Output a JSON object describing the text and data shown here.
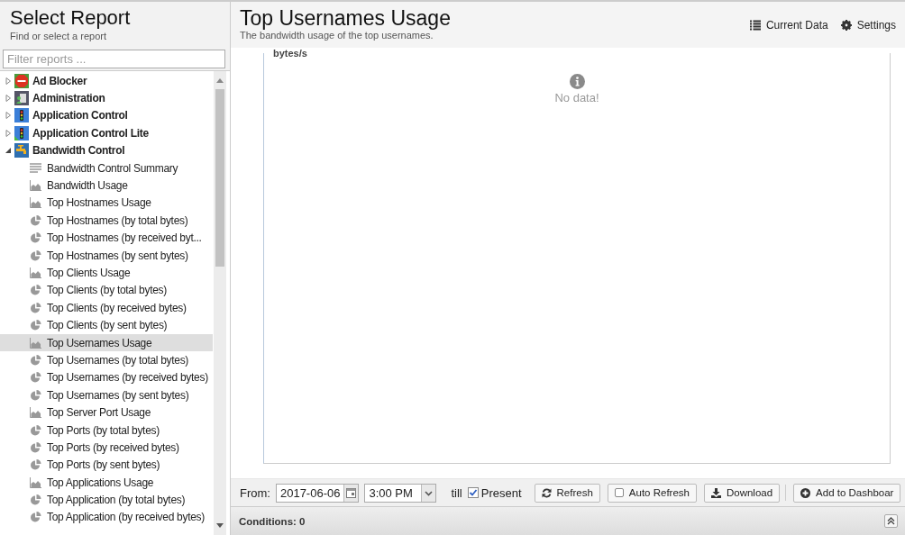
{
  "sidebar": {
    "title": "Select Report",
    "subtitle": "Find or select a report",
    "filter": {
      "placeholder": "Filter reports ..."
    },
    "tree": [
      {
        "label": "Ad Blocker",
        "kind": "ads",
        "expanded": false
      },
      {
        "label": "Administration",
        "kind": "admin",
        "expanded": false
      },
      {
        "label": "Application Control",
        "kind": "signal",
        "expanded": false
      },
      {
        "label": "Application Control Lite",
        "kind": "signal-lite",
        "expanded": false
      },
      {
        "label": "Bandwidth Control",
        "kind": "tap",
        "expanded": true,
        "children": [
          {
            "label": "Bandwidth Control Summary",
            "kind": "text",
            "selected": false
          },
          {
            "label": "Bandwidth Usage",
            "kind": "area",
            "selected": false
          },
          {
            "label": "Top Hostnames Usage",
            "kind": "area",
            "selected": false
          },
          {
            "label": "Top Hostnames (by total bytes)",
            "kind": "pie",
            "selected": false
          },
          {
            "label": "Top Hostnames (by received byt...",
            "kind": "pie",
            "selected": false
          },
          {
            "label": "Top Hostnames (by sent bytes)",
            "kind": "pie",
            "selected": false
          },
          {
            "label": "Top Clients Usage",
            "kind": "area",
            "selected": false
          },
          {
            "label": "Top Clients (by total bytes)",
            "kind": "pie",
            "selected": false
          },
          {
            "label": "Top Clients (by received bytes)",
            "kind": "pie",
            "selected": false
          },
          {
            "label": "Top Clients (by sent bytes)",
            "kind": "pie",
            "selected": false
          },
          {
            "label": "Top Usernames Usage",
            "kind": "area",
            "selected": true
          },
          {
            "label": "Top Usernames (by total bytes)",
            "kind": "pie",
            "selected": false
          },
          {
            "label": "Top Usernames (by received bytes)",
            "kind": "pie",
            "selected": false
          },
          {
            "label": "Top Usernames (by sent bytes)",
            "kind": "pie",
            "selected": false
          },
          {
            "label": "Top Server Port Usage",
            "kind": "area",
            "selected": false
          },
          {
            "label": "Top Ports (by total bytes)",
            "kind": "pie",
            "selected": false
          },
          {
            "label": "Top Ports (by received bytes)",
            "kind": "pie",
            "selected": false
          },
          {
            "label": "Top Ports (by sent bytes)",
            "kind": "pie",
            "selected": false
          },
          {
            "label": "Top Applications Usage",
            "kind": "area",
            "selected": false
          },
          {
            "label": "Top Application (by total bytes)",
            "kind": "pie",
            "selected": false
          },
          {
            "label": "Top Application (by received bytes)",
            "kind": "pie",
            "selected": false
          }
        ]
      }
    ]
  },
  "report": {
    "title": "Top Usernames Usage",
    "description": "The bandwidth usage of the top usernames.",
    "actions": [
      {
        "label": "Current Data",
        "kind": "list"
      },
      {
        "label": "Settings",
        "kind": "gear"
      }
    ],
    "chart": {
      "ylabel": "bytes/s",
      "message": "No data!"
    },
    "toolbar": {
      "from_label": "From:",
      "date": "2017-06-06",
      "time": "3:00 PM",
      "till_label": "till",
      "present": {
        "label": "Present",
        "checked": true
      },
      "buttons": [
        {
          "label": "Refresh",
          "kind": "refresh"
        },
        {
          "label": "Auto Refresh",
          "kind": "toggle",
          "checked": false
        },
        {
          "label": "Download",
          "kind": "download"
        },
        {
          "label": "Add to Dashboar",
          "kind": "add"
        }
      ]
    },
    "conditions": {
      "label": "Conditions: 0"
    }
  }
}
